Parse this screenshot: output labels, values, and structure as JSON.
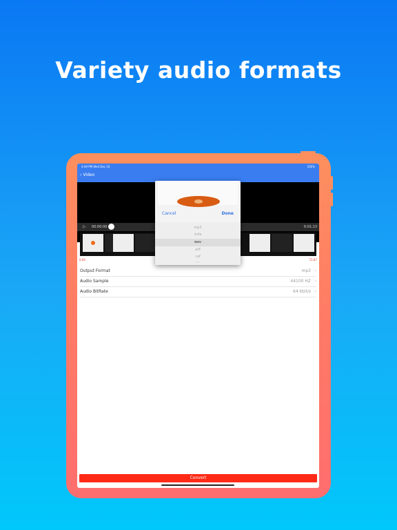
{
  "headline": "Variety audio formats",
  "status": {
    "time": "4:49 PM   Wed Dec 16",
    "battery": "100%"
  },
  "nav": {
    "back_label": "Video"
  },
  "timeline": {
    "start_time": "00:00:00",
    "end_time": "0:01:13"
  },
  "trim": {
    "left": "0.00",
    "right": "72.87"
  },
  "picker": {
    "cancel_label": "Cancel",
    "done_label": "Done",
    "options": [
      "mp3",
      "m4a",
      "wav",
      "aiff",
      "caf",
      "flac"
    ],
    "selected": "wav"
  },
  "settings": [
    {
      "label": "Output Format",
      "value": "mp3"
    },
    {
      "label": "Audio Sample",
      "value": "44100 HZ"
    },
    {
      "label": "Audio BitRate",
      "value": "64 kbit/s"
    }
  ],
  "convert_label": "Convert"
}
